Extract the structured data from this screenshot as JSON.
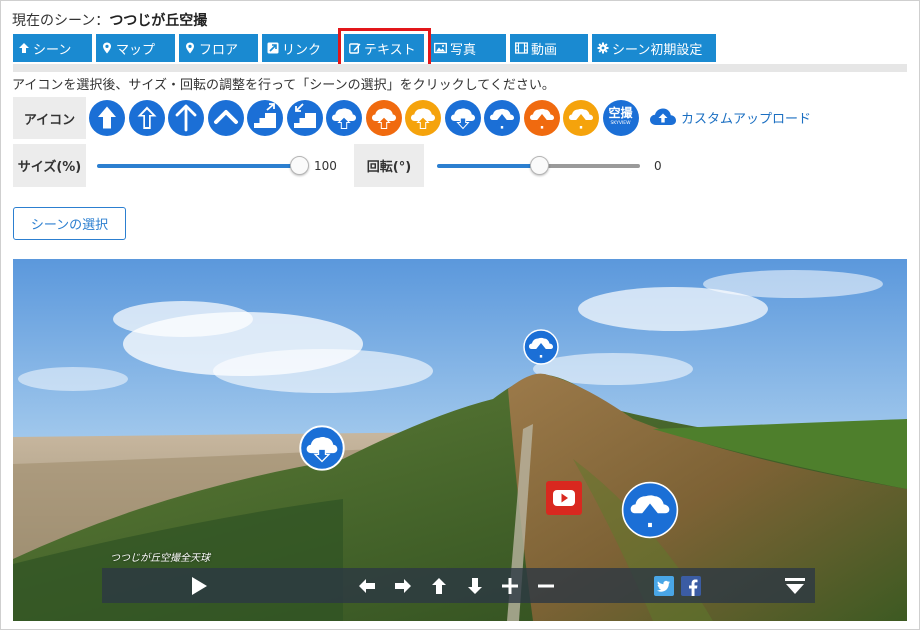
{
  "header": {
    "scene_prefix": "現在のシーン：",
    "scene_name": "つつじが丘空撮"
  },
  "tabs": [
    {
      "label": "シーン",
      "icon": "arrow-up-icon"
    },
    {
      "label": "マップ",
      "icon": "map-pin-icon"
    },
    {
      "label": "フロア",
      "icon": "map-pin-icon"
    },
    {
      "label": "リンク",
      "icon": "external-link-icon"
    },
    {
      "label": "テキスト",
      "icon": "edit-icon",
      "highlighted": true
    },
    {
      "label": "写真",
      "icon": "image-icon"
    },
    {
      "label": "動画",
      "icon": "film-icon"
    },
    {
      "label": "シーン初期設定",
      "icon": "gear-icon"
    }
  ],
  "instruction": "アイコンを選択後、サイズ・回転の調整を行って「シーンの選択」をクリックしてください。",
  "icon_panel": {
    "label": "アイコン",
    "icons": [
      {
        "name": "arrow-up-bold-icon",
        "color": "#1b6fd6"
      },
      {
        "name": "arrow-up-icon",
        "color": "#1b6fd6"
      },
      {
        "name": "arrow-up-thin-icon",
        "color": "#1b6fd6"
      },
      {
        "name": "chevron-up-icon",
        "color": "#1b6fd6"
      },
      {
        "name": "stairs-up-icon",
        "color": "#1b6fd6"
      },
      {
        "name": "stairs-down-icon",
        "color": "#1b6fd6"
      },
      {
        "name": "cloud-upload-icon",
        "color": "#1b6fd6"
      },
      {
        "name": "cloud-upload-orange-icon",
        "color": "#f06a0f"
      },
      {
        "name": "cloud-upload-yellow-icon",
        "color": "#f5a30c"
      },
      {
        "name": "cloud-download-icon",
        "color": "#1b6fd6"
      },
      {
        "name": "tree-icon",
        "color": "#1b6fd6"
      },
      {
        "name": "tree-orange-icon",
        "color": "#f06a0f"
      },
      {
        "name": "tree-yellow-icon",
        "color": "#f5a30c"
      },
      {
        "name": "skyview-logo-icon",
        "color": "#1b6fd6",
        "text": "空撮",
        "subtext": "SKYVIEW"
      }
    ],
    "custom_upload_label": "カスタムアップロード"
  },
  "size_control": {
    "label": "サイズ(%)",
    "value": "100",
    "fraction": 1.0
  },
  "rotation_control": {
    "label": "回転(°)",
    "value": "0",
    "fraction": 0.5
  },
  "select_button_label": "シーンの選択",
  "panorama": {
    "caption": "つつじが丘空撮全天球",
    "hotspots": [
      {
        "name": "tree-hotspot-top"
      },
      {
        "name": "cloud-download-hotspot"
      },
      {
        "name": "youtube-hotspot"
      },
      {
        "name": "tree-hotspot-large"
      }
    ],
    "controls": [
      "play-icon",
      "arrow-left-icon",
      "arrow-right-icon",
      "arrow-up-icon",
      "arrow-down-icon",
      "zoom-in-icon",
      "zoom-out-icon",
      "twitter-icon",
      "facebook-icon",
      "menu-collapse-icon"
    ]
  },
  "colors": {
    "accent": "#1a8ad1",
    "highlight": "#e2161a",
    "slider": "#2c7fd0"
  }
}
